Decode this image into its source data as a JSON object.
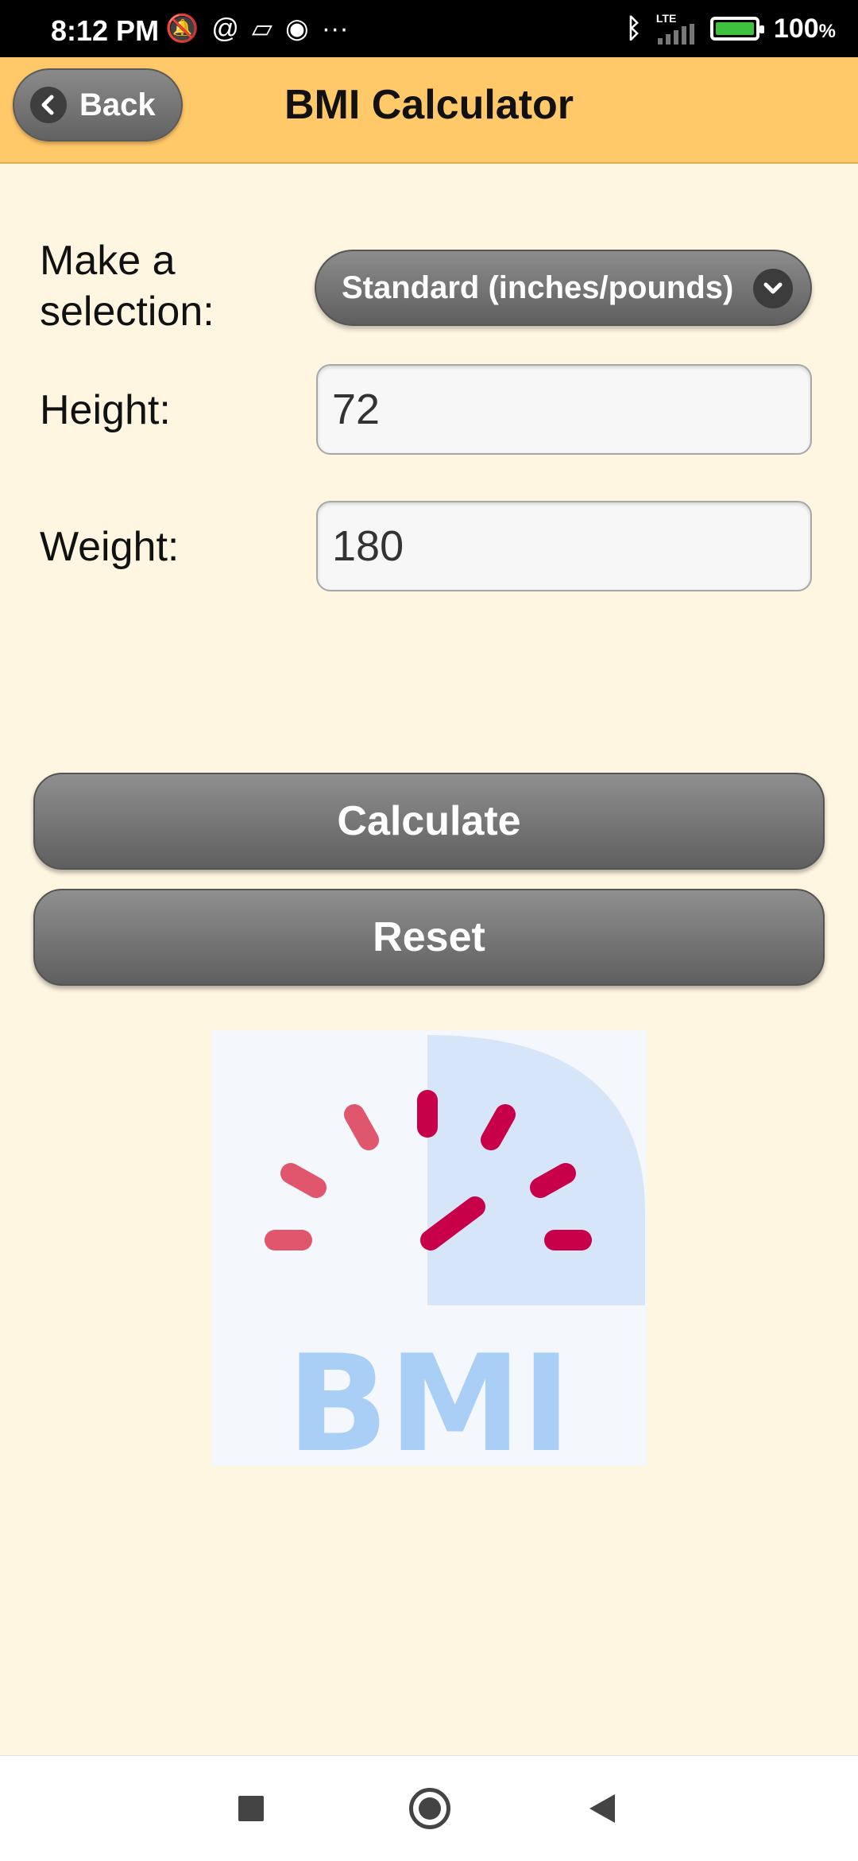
{
  "status_bar": {
    "time": "8:12 PM",
    "icons_left": [
      "mute-icon",
      "at-icon",
      "cards-icon",
      "chrome-icon",
      "more-dots-icon"
    ],
    "network": "LTE",
    "battery": "100",
    "battery_unit": "%"
  },
  "header": {
    "back_label": "Back",
    "title": "BMI Calculator"
  },
  "form": {
    "selection_label_line1": "Make a",
    "selection_label_line2": "selection:",
    "selection_value": "Standard (inches/pounds)",
    "height_label": "Height:",
    "height_value": "72",
    "weight_label": "Weight:",
    "weight_value": "180"
  },
  "buttons": {
    "calculate": "Calculate",
    "reset": "Reset"
  },
  "image": {
    "text": "BMI",
    "colors": {
      "gauge_ticks": "#e0566c",
      "gauge_needle": "#c8004a",
      "text": "#a9cff6",
      "panel": "#d6e6f8"
    }
  },
  "colors": {
    "header_bg": "#ffc868",
    "page_bg": "#fff6e1",
    "button_gray": "#707070"
  }
}
